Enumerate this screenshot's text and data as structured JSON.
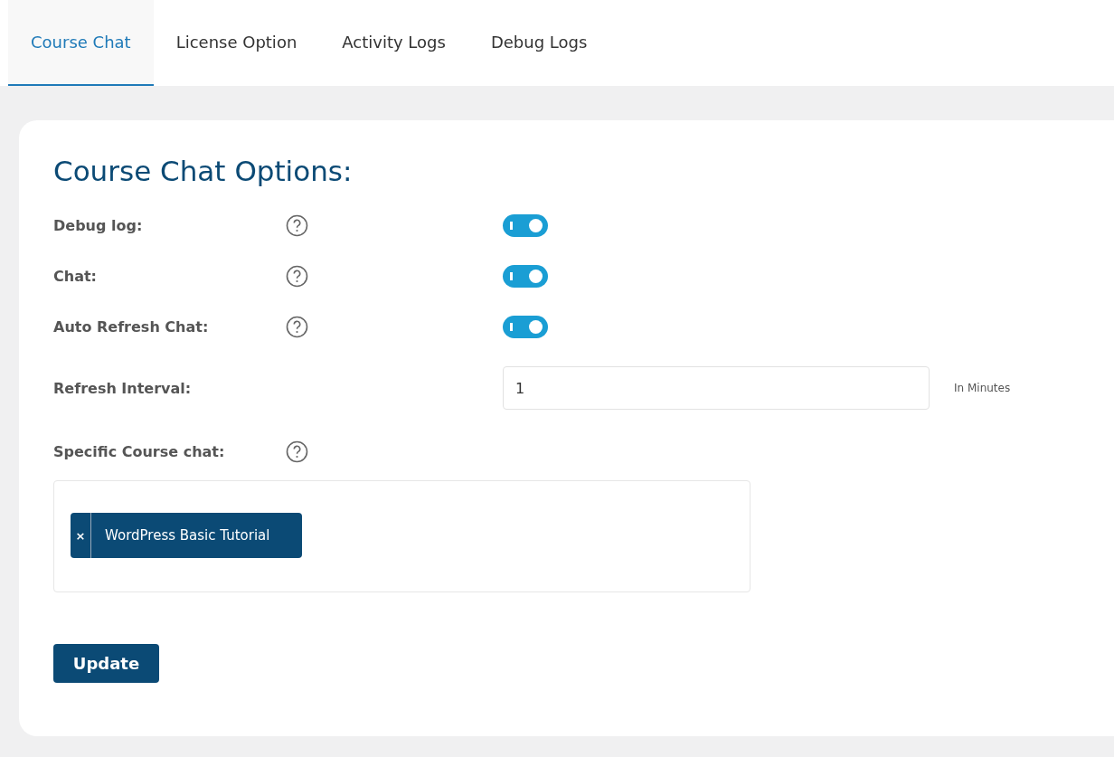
{
  "tabs": [
    {
      "label": "Course Chat",
      "selected": true
    },
    {
      "label": "License Option",
      "selected": false
    },
    {
      "label": "Activity Logs",
      "selected": false
    },
    {
      "label": "Debug Logs",
      "selected": false
    }
  ],
  "panel": {
    "title": "Course Chat Options:",
    "fields": [
      {
        "kind": "toggle",
        "label": "Debug log:",
        "help": true,
        "on": true
      },
      {
        "kind": "toggle",
        "label": "Chat:",
        "help": true,
        "on": true
      },
      {
        "kind": "toggle",
        "label": "Auto Refresh Chat:",
        "help": true,
        "on": true
      },
      {
        "kind": "number",
        "label": "Refresh Interval:",
        "help": false,
        "value": "1",
        "unit": "In Minutes"
      },
      {
        "kind": "multiselect",
        "label": "Specific Course chat:",
        "help": true,
        "tags": [
          {
            "remove": "×",
            "label": "WordPress Basic Tutorial"
          }
        ]
      }
    ],
    "button": "Update"
  }
}
